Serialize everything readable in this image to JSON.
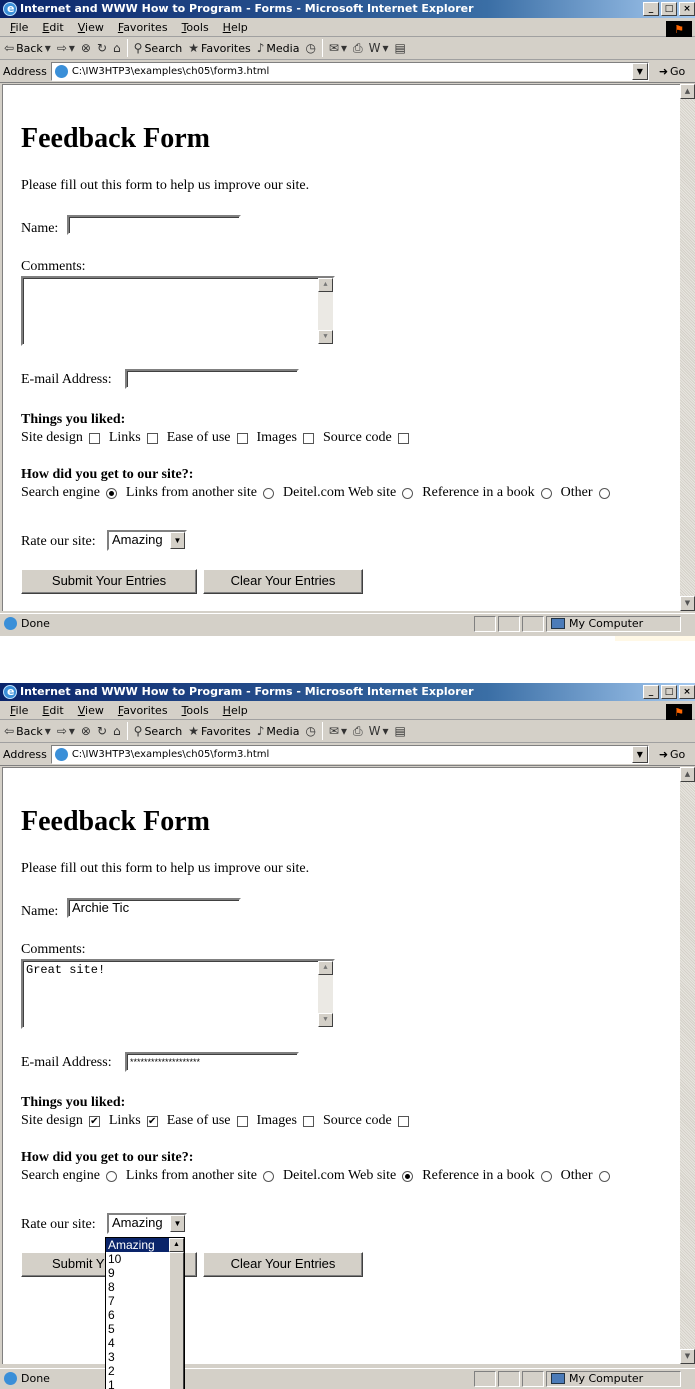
{
  "browser": {
    "title": "Internet and WWW How to Program - Forms - Microsoft Internet Explorer",
    "window_buttons": [
      "_",
      "□",
      "×"
    ],
    "menu": [
      "File",
      "Edit",
      "View",
      "Favorites",
      "Tools",
      "Help"
    ],
    "toolbar": {
      "back": "Back",
      "search": "Search",
      "favorites": "Favorites",
      "media": "Media"
    },
    "address_label": "Address",
    "address": "C:\\IW3HTP3\\examples\\ch05\\form3.html",
    "go": "Go",
    "status": "Done",
    "zone": "My Computer"
  },
  "form": {
    "heading": "Feedback Form",
    "intro": "Please fill out this form to help us improve our site.",
    "name_label": "Name:",
    "comments_label": "Comments:",
    "email_label": "E-mail Address:",
    "liked_heading": "Things you liked:",
    "liked_options": [
      "Site design",
      "Links",
      "Ease of use",
      "Images",
      "Source code"
    ],
    "source_heading": "How did you get to our site?:",
    "source_options": [
      "Search engine",
      "Links from another site",
      "Deitel.com Web site",
      "Reference in a book",
      "Other"
    ],
    "rate_label": "Rate our site:",
    "submit_label": "Submit Your Entries",
    "clear_label": "Clear Your Entries"
  },
  "screenshot1": {
    "name_value": "",
    "comments_value": "",
    "email_value": "",
    "liked_checked": [
      false,
      false,
      false,
      false,
      false
    ],
    "source_selected": "Search engine",
    "rating_value": "Amazing"
  },
  "screenshot2": {
    "name_value": "Archie Tic",
    "comments_value": "Great site!",
    "email_value": "********************",
    "liked_checked": [
      true,
      true,
      false,
      false,
      false
    ],
    "source_selected": "Deitel.com Web site",
    "rating_value": "Amazing",
    "submit_label_partial": "Submit Y",
    "dropdown_options": [
      "Amazing",
      "10",
      "9",
      "8",
      "7",
      "6",
      "5",
      "4",
      "3",
      "2",
      "1"
    ],
    "dropdown_highlighted": "Amazing"
  }
}
